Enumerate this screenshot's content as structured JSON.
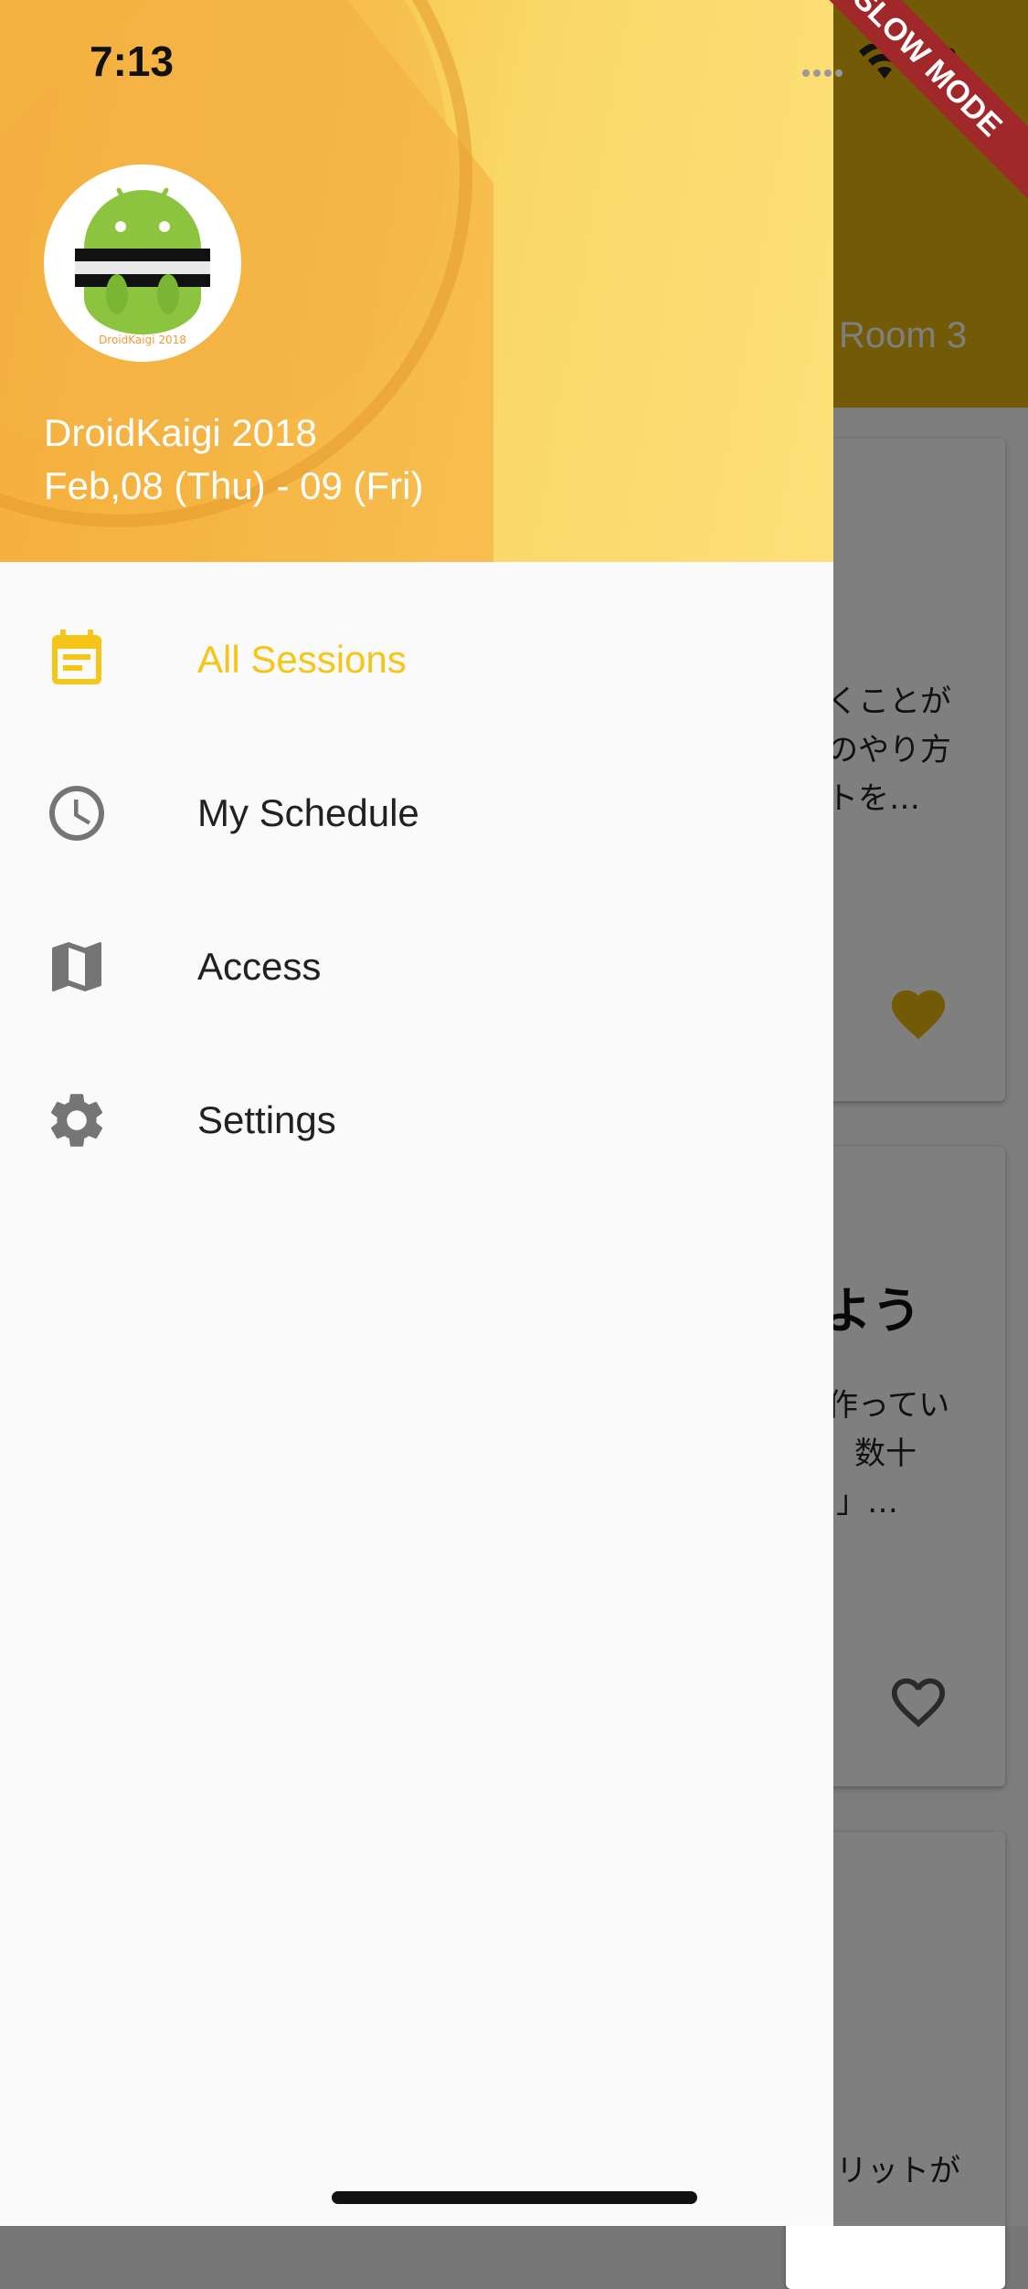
{
  "status_bar": {
    "time": "7:13"
  },
  "debug_banner": "SLOW MODE",
  "background": {
    "tab_label": "Room 3",
    "card1_lines": [
      "くことが",
      "のやり方",
      "トを…"
    ],
    "card2_title": "よう",
    "card2_lines": [
      "作ってい",
      "数十",
      "」…"
    ],
    "card3_lines": [
      "リットが"
    ]
  },
  "drawer": {
    "event_name": "DroidKaigi 2018",
    "event_dates": "Feb,08 (Thu) - 09 (Fri)",
    "logo_text": "DroidKaigi 2018",
    "menu": [
      {
        "label": "All Sessions",
        "icon": "event-note-icon",
        "active": true
      },
      {
        "label": "My Schedule",
        "icon": "clock-icon",
        "active": false
      },
      {
        "label": "Access",
        "icon": "map-icon",
        "active": false
      },
      {
        "label": "Settings",
        "icon": "gear-icon",
        "active": false
      }
    ]
  },
  "colors": {
    "accent": "#F5C518",
    "app_bar": "#E5B50F",
    "icon_gray": "#757575"
  }
}
